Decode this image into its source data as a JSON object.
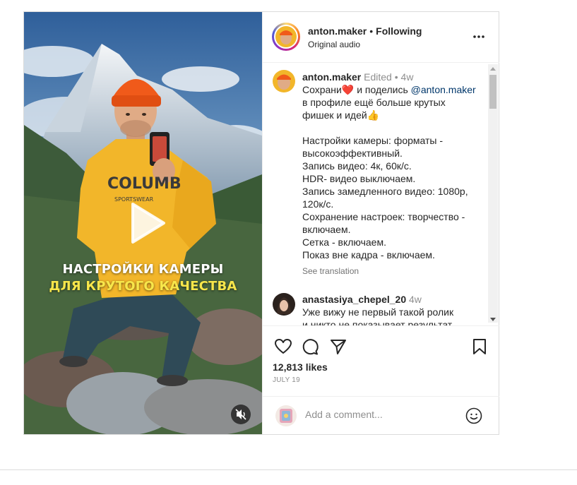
{
  "post": {
    "username": "anton.maker",
    "follow_status": "Following",
    "audio": "Original audio",
    "overlay_line1": "НАСТРОЙКИ КАМЕРЫ",
    "overlay_line2": "ДЛЯ КРУТОГО КАЧЕСТВА",
    "caption": {
      "username": "anton.maker",
      "edited": "Edited",
      "age": "4w",
      "line1_a": "Сохрани",
      "line1_b": " и поделись ",
      "mention": "@anton.maker",
      "line2": "в профиле ещё больше крутых",
      "line3": "фишек и идей",
      "body": [
        "Настройки камеры: форматы -",
        "высокоэффективный.",
        "Запись видео: 4к, 60к/с.",
        "HDR- видео выключаем.",
        "Запись замедленного видео: 1080р,",
        "120к/с.",
        "Сохранение настроек: творчество -",
        "включаем.",
        "Сетка - включаем.",
        "Показ вне кадра - включаем."
      ],
      "see_translation": "See translation"
    },
    "comment": {
      "username": "anastasiya_chepel_20",
      "age": "4w",
      "line1": "Уже вижу не первый такой ролик",
      "line2": "и никто не показывает результат"
    },
    "likes": "12,813 likes",
    "date": "JULY 19",
    "add_comment_placeholder": "Add a comment..."
  },
  "icons": {
    "like": "heart-icon",
    "comment": "comment-icon",
    "share": "paper-plane-icon",
    "save": "bookmark-icon",
    "emoji": "smiley-icon",
    "more": "more-options-icon",
    "play": "play-icon",
    "mute": "muted-speaker-icon"
  },
  "colors": {
    "accent_link": "#00376b",
    "overlay_highlight": "#f7e64a",
    "hat": "#f05a1a",
    "hoodie": "#f2b62a"
  }
}
